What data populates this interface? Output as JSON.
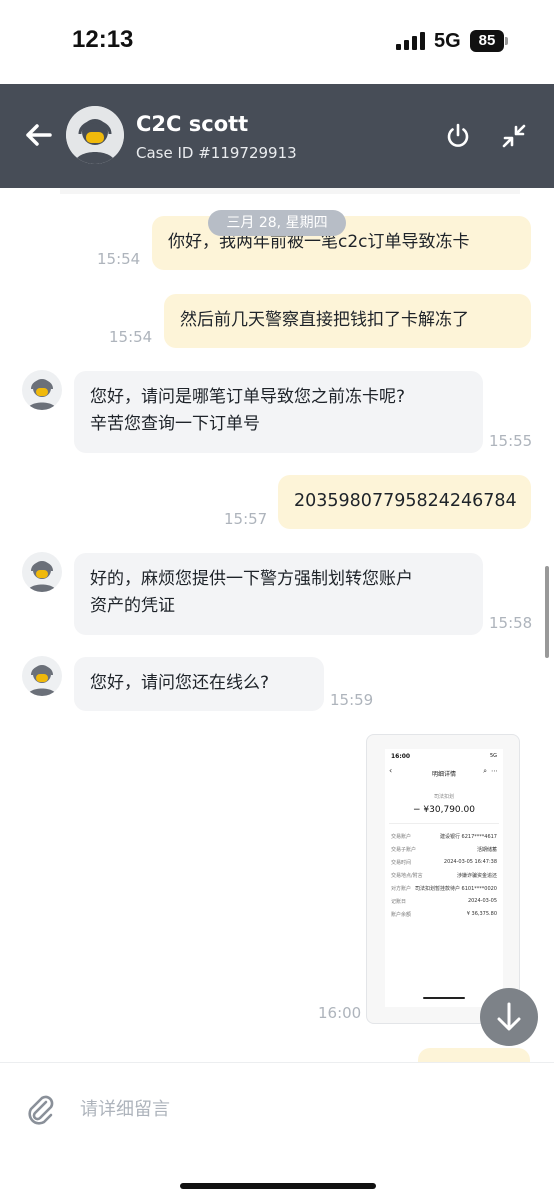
{
  "status_bar": {
    "time": "12:13",
    "network": "5G",
    "battery": "85"
  },
  "header": {
    "title": "C2C scott",
    "subtitle": "Case ID #119729913",
    "icons": [
      "back-arrow-icon",
      "power-icon",
      "minimize-icon",
      "agent-avatar"
    ]
  },
  "chat": {
    "date_divider": "三月 28, 星期四",
    "messages": [
      {
        "dir": "out",
        "text": "你好，我两年前被一笔c2c订单导致冻卡",
        "time": "15:54"
      },
      {
        "dir": "out",
        "text": "然后前几天警察直接把钱扣了卡解冻了",
        "time": "15:54"
      },
      {
        "dir": "in",
        "lines": [
          "您好，请问是哪笔订单导致您之前冻卡呢?",
          "辛苦您查询一下订单号"
        ],
        "time": "15:55"
      },
      {
        "dir": "out",
        "text": "20359807795824246784",
        "time": "15:57"
      },
      {
        "dir": "in",
        "lines": [
          "好的，麻烦您提供一下警方强制划转您账户",
          "资产的凭证"
        ],
        "time": "15:58"
      },
      {
        "dir": "in",
        "lines": [
          "您好，请问您还在线么?"
        ],
        "time": "15:59"
      }
    ],
    "image_message": {
      "time": "16:00",
      "screenshot": {
        "status_time": "16:00",
        "status_net": "5G",
        "title": "明细详情",
        "type_label": "司法扣划",
        "amount": "− ¥30,790.00",
        "rows": [
          {
            "label": "交易账户",
            "value": "建设银行 6217****4617"
          },
          {
            "label": "交易子账户",
            "value": "活期储蓄"
          },
          {
            "label": "交易时间",
            "value": "2024-03-05 16:47:38"
          },
          {
            "label": "交易地点/附言",
            "value": "涉嫌诈骗资金追还"
          },
          {
            "label": "对方账户",
            "value": "司法扣划暂挂款待户 6101****0020"
          },
          {
            "label": "记账日",
            "value": "2024-03-05"
          },
          {
            "label": "账户余额",
            "value": "¥ 36,375.80"
          }
        ]
      }
    }
  },
  "input": {
    "placeholder": "请详细留言"
  },
  "colors": {
    "header_bg": "#474d57",
    "outgoing_bubble": "#fdf4d8",
    "incoming_bubble": "#f3f4f6",
    "accent_yellow": "#f0b90b"
  }
}
